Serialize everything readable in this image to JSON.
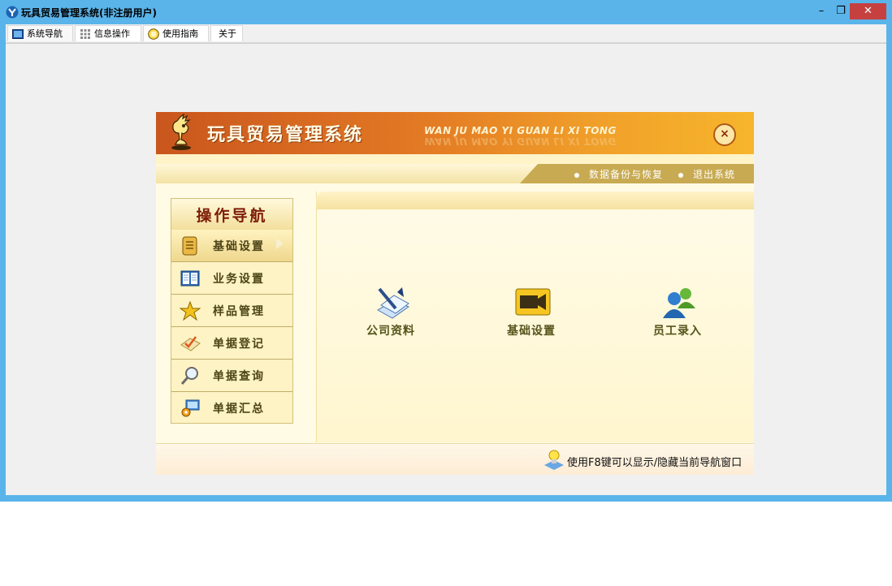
{
  "window": {
    "title": "玩具贸易管理系统(非注册用户)",
    "controls": {
      "minimize": "–",
      "restore": "❐",
      "close": "✕"
    }
  },
  "tabs": [
    {
      "label": "系统导航",
      "icon": "window-icon"
    },
    {
      "label": "信息操作",
      "icon": "grid-icon"
    },
    {
      "label": "使用指南",
      "icon": "help-icon"
    },
    {
      "label": "关于",
      "icon": ""
    }
  ],
  "banner": {
    "title": "玩具贸易管理系统",
    "subtitle": "WAN JU MAO YI GUAN LI XI TONG",
    "close_label": "×"
  },
  "menu": {
    "backup": "数据备份与恢复",
    "exit": "退出系统"
  },
  "nav": {
    "header": "操作导航",
    "items": [
      {
        "label": "基础设置",
        "icon": "ledger-icon",
        "active": true
      },
      {
        "label": "业务设置",
        "icon": "book-icon",
        "active": false
      },
      {
        "label": "样品管理",
        "icon": "star-icon",
        "active": false
      },
      {
        "label": "单据登记",
        "icon": "checkmark-note-icon",
        "active": false
      },
      {
        "label": "单据查询",
        "icon": "magnifier-icon",
        "active": false
      },
      {
        "label": "单据汇总",
        "icon": "computer-gear-icon",
        "active": false
      }
    ]
  },
  "features": [
    {
      "label": "公司资料",
      "icon": "pen-paper-icon"
    },
    {
      "label": "基础设置",
      "icon": "video-camera-icon"
    },
    {
      "label": "员工录入",
      "icon": "users-icon"
    }
  ],
  "footer": {
    "hint": "使用F8键可以显示/隐藏当前导航窗口"
  },
  "colors": {
    "titlebar": "#5ab4ea",
    "close_button": "#c74040",
    "banner_orange": "#e37a24",
    "nav_text": "#7d1c07",
    "menu_gold": "#c8aa52"
  }
}
